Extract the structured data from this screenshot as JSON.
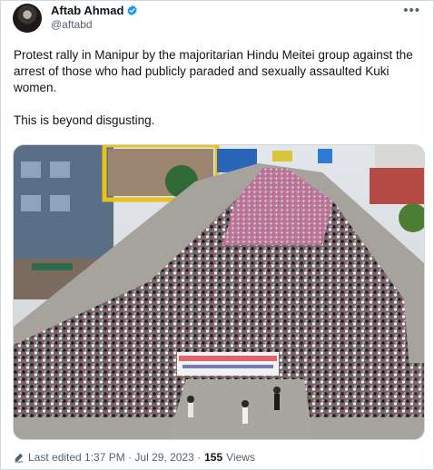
{
  "author": {
    "name": "Aftab Ahmad",
    "handle": "@aftabd",
    "verified_color": "#1d9bf0"
  },
  "more_icon": "more-horizontal-icon",
  "tweet": {
    "text": "Protest rally in Manipur by the majoritarian Hindu Meitei group against the arrest of those who had publicly paraded and sexually assaulted Kuki women.\n\nThis is beyond disgusting."
  },
  "footer": {
    "edited_label": "Last edited 1:37 PM · Jul 29, 2023 · ",
    "views_count": "155",
    "views_label": "Views"
  },
  "colors": {
    "text": "#0f1419",
    "secondary": "#536471",
    "border": "#cfd9de"
  }
}
